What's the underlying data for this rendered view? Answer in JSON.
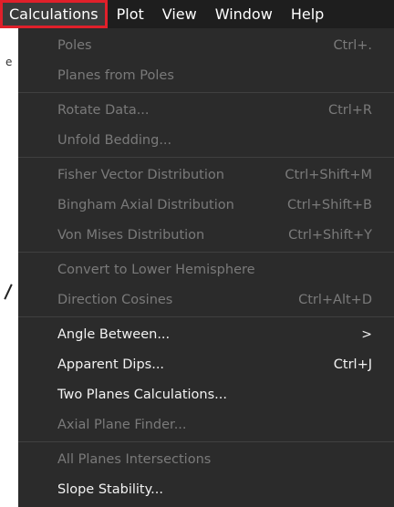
{
  "menubar": {
    "items": [
      "Calculations",
      "Plot",
      "View",
      "Window",
      "Help"
    ]
  },
  "background": {
    "fragment": "e"
  },
  "menu": {
    "items": [
      {
        "label": "Poles",
        "shortcut": "Ctrl+.",
        "enabled": false
      },
      {
        "label": "Planes from Poles",
        "shortcut": "",
        "enabled": false
      },
      {
        "label": "Rotate Data...",
        "shortcut": "Ctrl+R",
        "enabled": false
      },
      {
        "label": "Unfold Bedding...",
        "shortcut": "",
        "enabled": false
      },
      {
        "label": "Fisher Vector Distribution",
        "shortcut": "Ctrl+Shift+M",
        "enabled": false
      },
      {
        "label": "Bingham Axial Distribution",
        "shortcut": "Ctrl+Shift+B",
        "enabled": false
      },
      {
        "label": "Von Mises Distribution",
        "shortcut": "Ctrl+Shift+Y",
        "enabled": false
      },
      {
        "label": "Convert to Lower Hemisphere",
        "shortcut": "",
        "enabled": false
      },
      {
        "label": "Direction Cosines",
        "shortcut": "Ctrl+Alt+D",
        "enabled": false
      },
      {
        "label": "Angle Between...",
        "shortcut": "",
        "enabled": true,
        "submenu_arrow": ">"
      },
      {
        "label": "Apparent Dips...",
        "shortcut": "Ctrl+J",
        "enabled": true
      },
      {
        "label": "Two Planes Calculations...",
        "shortcut": "",
        "enabled": true
      },
      {
        "label": "Axial Plane Finder...",
        "shortcut": "",
        "enabled": false
      },
      {
        "label": "All Planes Intersections",
        "shortcut": "",
        "enabled": false
      },
      {
        "label": "Slope Stability...",
        "shortcut": "",
        "enabled": true
      }
    ]
  },
  "colors": {
    "menubar_bg": "#1e1e1e",
    "menu_bg": "#2b2b2b",
    "enabled_text": "#f2f2f2",
    "disabled_text": "#7a7a7a",
    "highlight_border": "#e0202a"
  }
}
